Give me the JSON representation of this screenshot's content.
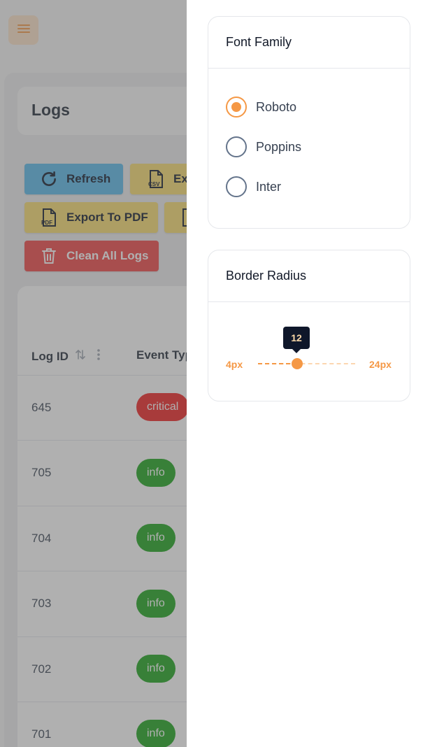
{
  "app": {
    "page_title": "Logs",
    "colors": {
      "accent": "#f59845",
      "refresh": "#56b8ea",
      "export": "#f9dd6e",
      "danger": "#ef4444",
      "critical": "#ef1f1f",
      "info": "#1aa31a"
    },
    "toolbar": {
      "refresh_label": "Refresh",
      "export_csv_label": "Exp",
      "export_pdf_label": "Export To PDF",
      "clean_label": "Clean All Logs",
      "icons": [
        "refresh-icon",
        "csv-file-icon",
        "pdf-file-icon",
        "trash-icon"
      ]
    },
    "table": {
      "columns": [
        "Log ID",
        "Event Typ"
      ],
      "rows": [
        {
          "id": "645",
          "event_type": "critical"
        },
        {
          "id": "705",
          "event_type": "info"
        },
        {
          "id": "704",
          "event_type": "info"
        },
        {
          "id": "703",
          "event_type": "info"
        },
        {
          "id": "702",
          "event_type": "info"
        },
        {
          "id": "701",
          "event_type": "info"
        }
      ]
    }
  },
  "settings": {
    "font_family": {
      "title": "Font Family",
      "options": [
        "Roboto",
        "Poppins",
        "Inter"
      ],
      "selected": "Roboto"
    },
    "border_radius": {
      "title": "Border Radius",
      "min_label": "4px",
      "max_label": "24px",
      "min": 4,
      "max": 24,
      "value": 12,
      "value_label": "12"
    }
  }
}
